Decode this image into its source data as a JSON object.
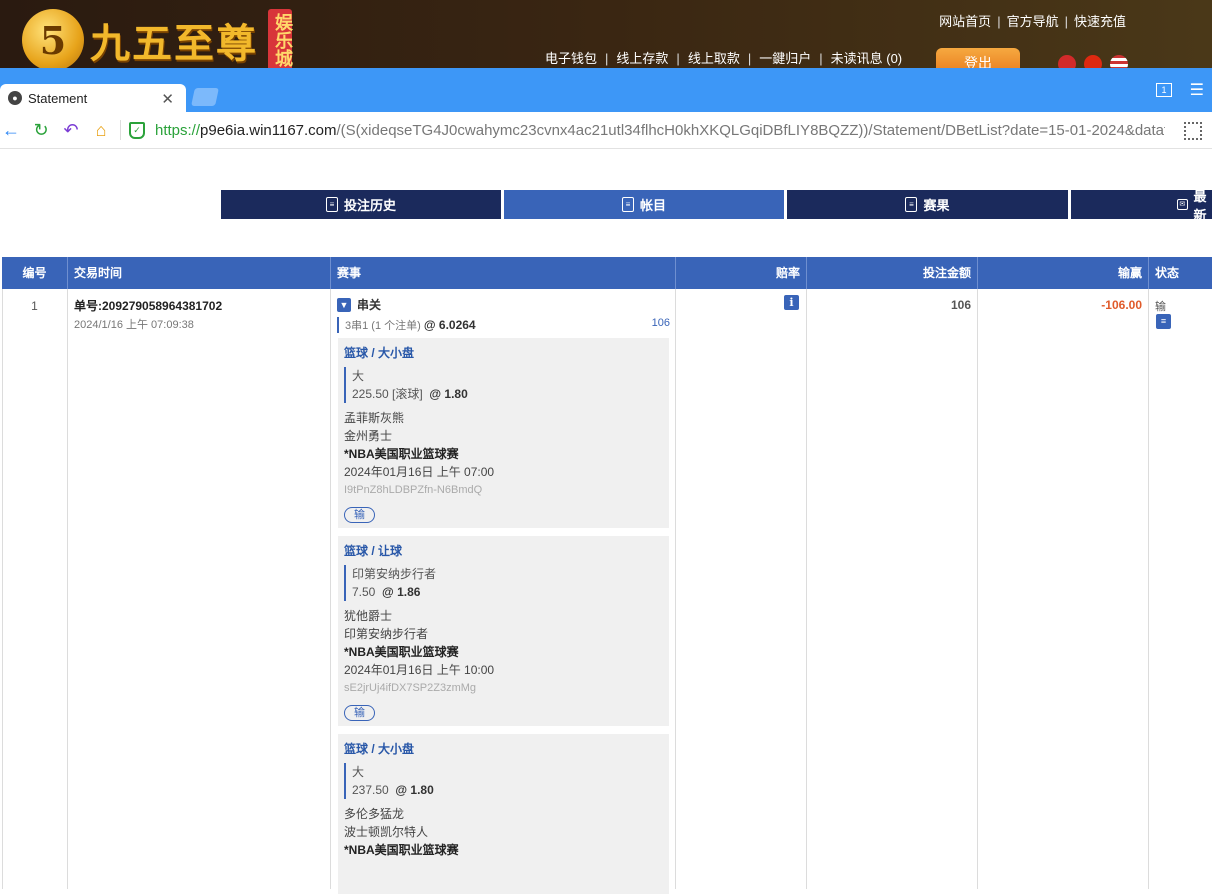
{
  "site": {
    "logo_mark": "5",
    "logo_text": "九五至尊",
    "logo_badge": "娱乐城",
    "top_links": [
      "网站首页",
      "官方导航",
      "快速充值"
    ],
    "nav_links": [
      "电子钱包",
      "线上存款",
      "线上取款",
      "一鍵归户",
      "未读讯息 (0)"
    ],
    "logout": "登出"
  },
  "browser": {
    "tab_title": "Statement",
    "window_count": "1",
    "url_scheme": "https://",
    "url_host": "p9e6ia.win1167.com",
    "url_path": "/(S(xideqseTG4J0cwahymc23cvnx4ac21utl34flhcH0khXKQLGqiDBfLIY8BQZZ))/Statement/DBetList?date=15-01-2024&datat"
  },
  "page_tabs": [
    "投注历史",
    "帐目",
    "赛果",
    "最新"
  ],
  "table": {
    "headers": [
      "编号",
      "交易时间",
      "赛事",
      "赔率",
      "投注金额",
      "输赢",
      "状态"
    ],
    "rows": [
      {
        "no": "1",
        "ticket": "单号:209279058964381702",
        "time": "2024/1/16 上午 07:09:38",
        "parlay_label": "串关",
        "parlay_type": "3串1 (1 个注单)",
        "parlay_odds": "@ 6.0264",
        "parlay_amount": "106",
        "stake": "106",
        "winloss": "-106.00",
        "status": "输",
        "legs": [
          {
            "title": "篮球 / 大小盘",
            "selection": "大",
            "line": "225.50 [滚球]",
            "odds": "@ 1.80",
            "home": "孟菲斯灰熊",
            "away": "金州勇士",
            "league": "*NBA美国职业篮球赛",
            "datetime": "2024年01月16日 上午 07:00",
            "ref": "I9tPnZ8hLDBPZfn-N6BmdQ",
            "result": "输"
          },
          {
            "title": "篮球 / 让球",
            "selection": "印第安纳步行者",
            "line": "7.50",
            "odds": "@ 1.86",
            "home": "犹他爵士",
            "away": "印第安纳步行者",
            "league": "*NBA美国职业篮球赛",
            "datetime": "2024年01月16日 上午 10:00",
            "ref": "sE2jrUj4ifDX7SP2Z3zmMg",
            "result": "输"
          },
          {
            "title": "篮球 / 大小盘",
            "selection": "大",
            "line": "237.50",
            "odds": "@ 1.80",
            "home": "多伦多猛龙",
            "away": "波士顿凯尔特人",
            "league": "*NBA美国职业篮球赛",
            "datetime": "",
            "ref": "",
            "result": ""
          }
        ]
      }
    ]
  }
}
